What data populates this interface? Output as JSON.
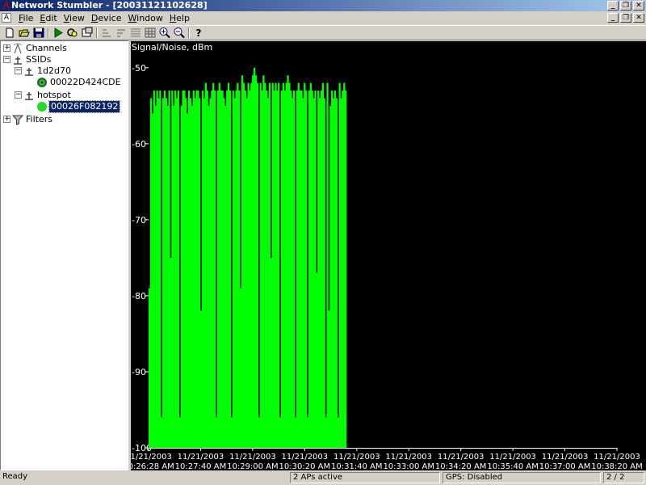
{
  "window": {
    "title": "Network Stumbler - [20031121102628]",
    "controls": [
      "_",
      "❐",
      "✕"
    ]
  },
  "menu": {
    "items": [
      "File",
      "Edit",
      "View",
      "Device",
      "Window",
      "Help"
    ],
    "mnemonics": [
      "F",
      "E",
      "V",
      "D",
      "W",
      "H"
    ]
  },
  "toolbar": {
    "buttons": [
      "new-icon",
      "open-icon",
      "save-icon",
      "play-icon",
      "auto-config-icon",
      "properties-icon",
      "sort-asc-icon",
      "sort-desc-icon",
      "list-view-icon",
      "grid-icon",
      "zoom-in-icon",
      "zoom-out-icon",
      "help-icon"
    ]
  },
  "tree": {
    "channels": "Channels",
    "ssids": "SSIDs",
    "ssid1": "1d2d70",
    "ap1": "00022D424CDE",
    "ssid2": "hotspot",
    "ap2": "00026F082192",
    "filters": "Filters",
    "ap2_selected": true,
    "colors": {
      "ap_green": "#22dd22",
      "ap_dark_ring": "#2a6a2a"
    }
  },
  "chart_data": {
    "type": "bar",
    "title": "Signal/Noise, dBm",
    "ylim": [
      -100,
      -48
    ],
    "yticks": [
      -50,
      -60,
      -70,
      -80,
      -90,
      -100
    ],
    "xlim": [
      "10:26:28 AM",
      "10:38:40 AM"
    ],
    "xticks": [
      {
        "date": "11/21/2003",
        "time": "10:26:28 AM"
      },
      {
        "date": "11/21/2003",
        "time": "10:27:40 AM"
      },
      {
        "date": "11/21/2003",
        "time": "10:29:00 AM"
      },
      {
        "date": "11/21/2003",
        "time": "10:30:20 AM"
      },
      {
        "date": "11/21/2003",
        "time": "10:31:40 AM"
      },
      {
        "date": "11/21/2003",
        "time": "10:33:00 AM"
      },
      {
        "date": "11/21/2003",
        "time": "10:34:20 AM"
      },
      {
        "date": "11/21/2003",
        "time": "10:35:40 AM"
      },
      {
        "date": "11/21/2003",
        "time": "10:37:00 AM"
      },
      {
        "date": "11/21/2003",
        "time": "10:38:20 AM"
      }
    ],
    "data_end_time": "10:31:20 AM",
    "series": [
      {
        "color": "#00ff00",
        "values": [
          -79,
          -54,
          -56,
          -53,
          -55,
          -53,
          -54,
          -53,
          -55,
          -54,
          -53,
          -54,
          -55,
          -53,
          -54,
          -53,
          -55,
          -53,
          -54,
          -53,
          -54,
          -55,
          -53,
          -53,
          -54,
          -56,
          -53,
          -54,
          -55,
          -53,
          -54,
          -53,
          -53,
          -54,
          -55,
          -53,
          -54,
          -52,
          -53,
          -55,
          -54,
          -53,
          -52,
          -53,
          -54,
          -53,
          -52,
          -53,
          -53,
          -54,
          -55,
          -53,
          -52,
          -53,
          -51,
          -53,
          -54,
          -53,
          -52,
          -53,
          -52,
          -51,
          -52,
          -53,
          -54,
          -52,
          -53,
          -52,
          -51,
          -50,
          -51,
          -52,
          -53,
          -52,
          -53,
          -51,
          -52,
          -53,
          -54,
          -52,
          -51,
          -52,
          -53,
          -52,
          -53,
          -52,
          -51,
          -53,
          -52,
          -53,
          -52,
          -51,
          -52,
          -53,
          -54,
          -53,
          -52,
          -53,
          -52,
          -53,
          -53,
          -54,
          -52,
          -53,
          -54,
          -53,
          -52,
          -53,
          -54,
          -53,
          -55,
          -53,
          -54,
          -53,
          -52,
          -54,
          -53,
          -52,
          -54,
          -55,
          -53,
          -54,
          -53,
          -54,
          -53,
          -52,
          -54,
          -53,
          -52,
          -53
        ]
      }
    ],
    "dropouts": [
      {
        "index": 8,
        "value": -96
      },
      {
        "index": 14,
        "value": -75
      },
      {
        "index": 20,
        "value": -96
      },
      {
        "index": 34,
        "value": -82
      },
      {
        "index": 44,
        "value": -96
      },
      {
        "index": 54,
        "value": -96
      },
      {
        "index": 60,
        "value": -79
      },
      {
        "index": 72,
        "value": -96
      },
      {
        "index": 80,
        "value": -75
      },
      {
        "index": 86,
        "value": -96
      },
      {
        "index": 96,
        "value": -96
      },
      {
        "index": 104,
        "value": -96
      },
      {
        "index": 110,
        "value": -77
      },
      {
        "index": 116,
        "value": -96
      },
      {
        "index": 118,
        "value": -82
      },
      {
        "index": 124,
        "value": -96
      }
    ]
  },
  "status": {
    "left": "Ready",
    "aps": "2 APs active",
    "gps": "GPS: Disabled",
    "count": "2 / 2"
  }
}
